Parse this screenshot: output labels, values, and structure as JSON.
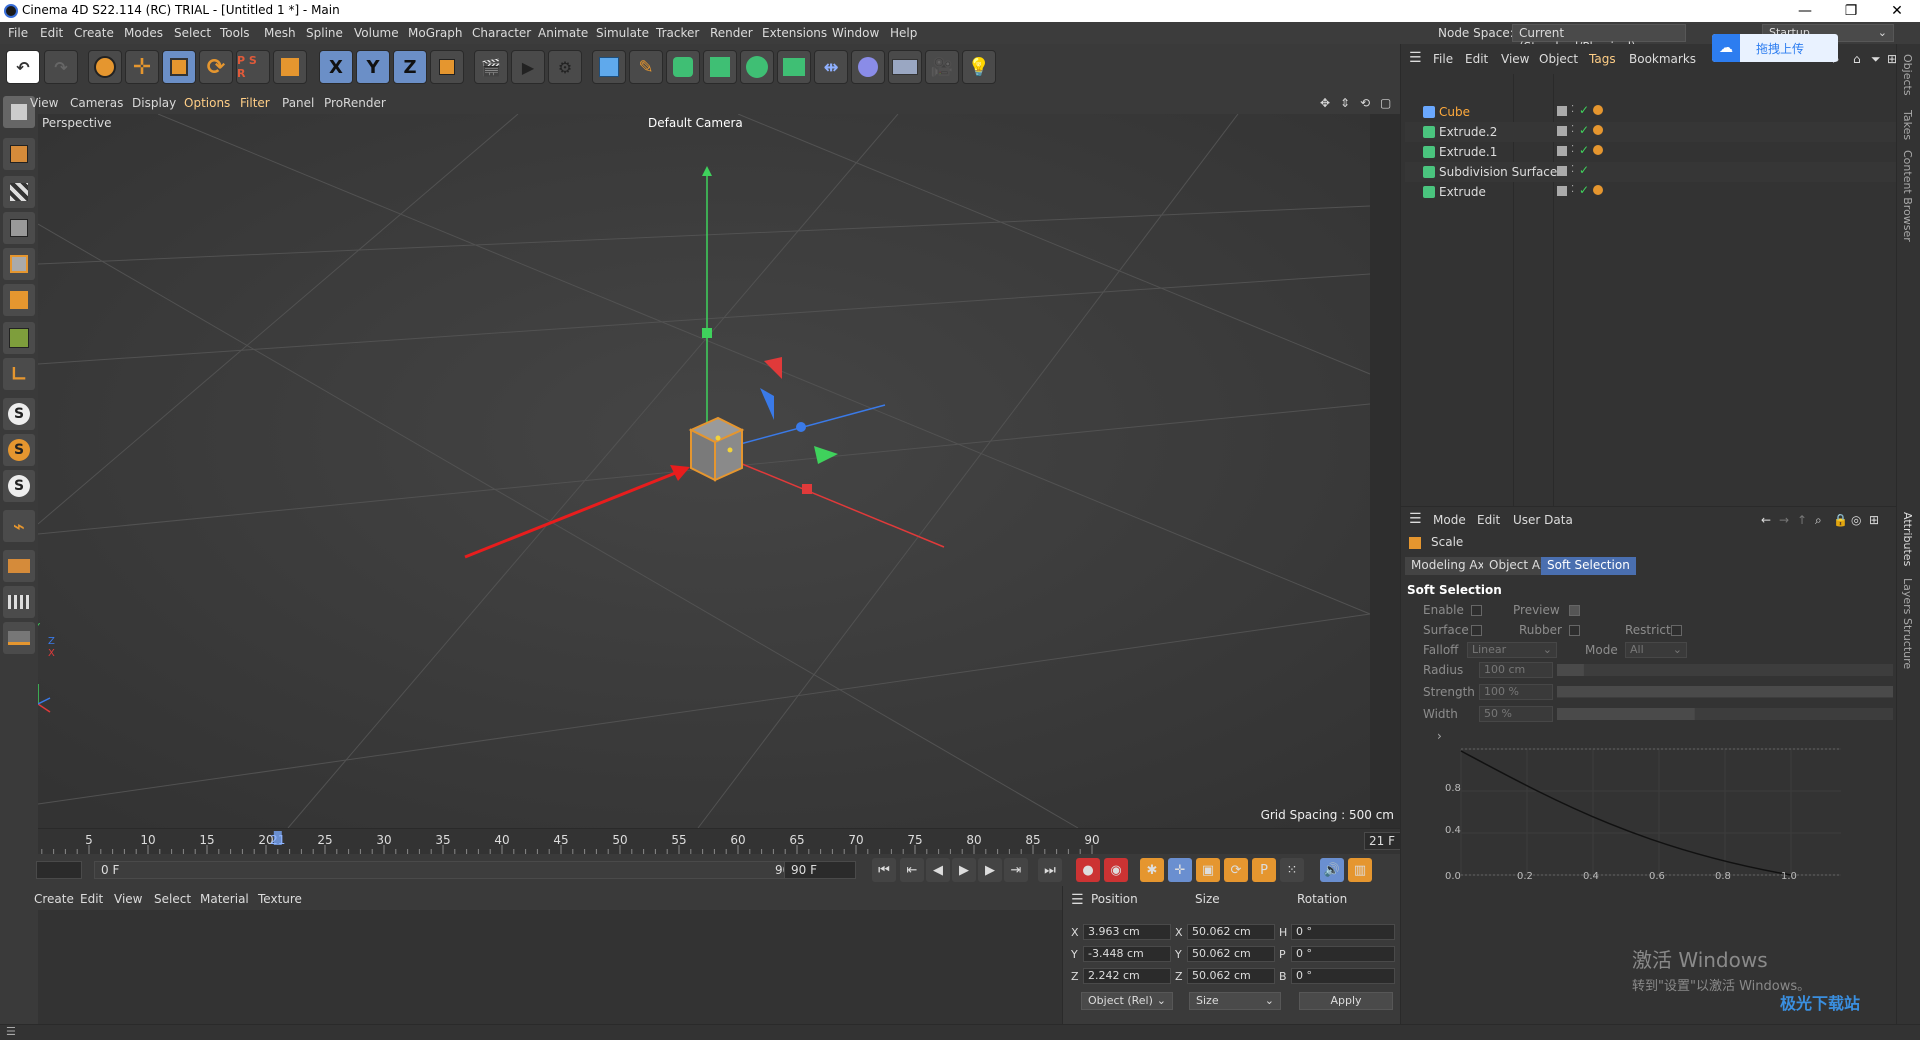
{
  "window": {
    "title": "Cinema 4D S22.114 (RC) TRIAL - [Untitled 1 *] - Main",
    "minimize": "—",
    "maximize": "❐",
    "close": "✕"
  },
  "menubar": {
    "items": [
      "File",
      "Edit",
      "Create",
      "Modes",
      "Select",
      "Tools",
      "Mesh",
      "Spline",
      "Volume",
      "MoGraph",
      "Character",
      "Animate",
      "Simulate",
      "Tracker",
      "Render",
      "Extensions",
      "Window",
      "Help"
    ],
    "node_space_label": "Node Space:",
    "node_space_value": "Current (Standard/Physical)",
    "layout_value": "Startup"
  },
  "toolbar": {
    "axis_x": "X",
    "axis_y": "Y",
    "axis_z": "Z"
  },
  "viewport": {
    "menu": [
      "View",
      "Cameras",
      "Display",
      "Options",
      "Filter",
      "Panel",
      "ProRender"
    ],
    "highlighted_menu": [
      "Options",
      "Filter"
    ],
    "perspective_label": "Perspective",
    "camera_label": "Default Camera",
    "grid_spacing": "Grid Spacing : 500 cm",
    "axis_labels": {
      "y": "Y",
      "z": "Z",
      "x": "X"
    }
  },
  "timeline": {
    "ticks": [
      5,
      10,
      15,
      20,
      21,
      25,
      30,
      35,
      40,
      45,
      50,
      55,
      60,
      65,
      70,
      75,
      80,
      85,
      90
    ],
    "current_frame": 21,
    "current_frame_label": "21 F",
    "range_start": "0 F",
    "range_end": "90 F",
    "max_frame": "90 F",
    "start_field": "0 F"
  },
  "material": {
    "menu": [
      "Create",
      "Edit",
      "View",
      "Select",
      "Material",
      "Texture"
    ]
  },
  "coordinates": {
    "headers": [
      "Position",
      "Size",
      "Rotation"
    ],
    "rows": [
      {
        "axis": "X",
        "pos": "3.963 cm",
        "size_axis": "X",
        "size": "50.062 cm",
        "rot_axis": "H",
        "rot": "0 °"
      },
      {
        "axis": "Y",
        "pos": "-3.448 cm",
        "size_axis": "Y",
        "size": "50.062 cm",
        "rot_axis": "P",
        "rot": "0 °"
      },
      {
        "axis": "Z",
        "pos": "2.242 cm",
        "size_axis": "Z",
        "size": "50.062 cm",
        "rot_axis": "B",
        "rot": "0 °"
      }
    ],
    "mode_select": "Object (Rel)",
    "size_select": "Size",
    "apply": "Apply"
  },
  "objects": {
    "menu": [
      "File",
      "Edit",
      "View",
      "Object",
      "Tags",
      "Bookmarks"
    ],
    "highlighted_menu": "Tags",
    "items": [
      {
        "name": "Cube",
        "selected": true,
        "icon_color": "#6aa8ff"
      },
      {
        "name": "Extrude.2",
        "selected": false,
        "icon_color": "#4ac47e"
      },
      {
        "name": "Extrude.1",
        "selected": false,
        "icon_color": "#4ac47e"
      },
      {
        "name": "Subdivision Surface",
        "selected": false,
        "icon_color": "#4ac47e"
      },
      {
        "name": "Extrude",
        "selected": false,
        "icon_color": "#4ac47e"
      }
    ]
  },
  "attributes": {
    "menu": [
      "Mode",
      "Edit",
      "User Data"
    ],
    "object_label": "Scale",
    "tabs": [
      "Modeling Axis",
      "Object Axis",
      "Soft Selection"
    ],
    "active_tab": "Soft Selection",
    "section_title": "Soft Selection",
    "enable": "Enable",
    "preview": "Preview",
    "surface": "Surface",
    "rubber": "Rubber",
    "restrict": "Restrict",
    "falloff": "Falloff",
    "falloff_value": "Linear",
    "mode": "Mode",
    "mode_value": "All",
    "radius": "Radius",
    "radius_value": "100 cm",
    "strength": "Strength",
    "strength_value": "100 %",
    "width": "Width",
    "width_value": "50 %",
    "graph_y_ticks": [
      "0.8",
      "0.4",
      "0.0"
    ],
    "graph_x_ticks": [
      "0.2",
      "0.4",
      "0.6",
      "0.8",
      "1.0"
    ]
  },
  "side_tabs": [
    "Objects",
    "Takes",
    "Content Browser",
    "Attributes",
    "Layers",
    "Structure"
  ],
  "overlays": {
    "upload_label": "拖拽上传",
    "watermark_line1": "激活 Windows",
    "watermark_line2": "转到\"设置\"以激活 Windows。",
    "site_watermark": "极光下载站"
  }
}
